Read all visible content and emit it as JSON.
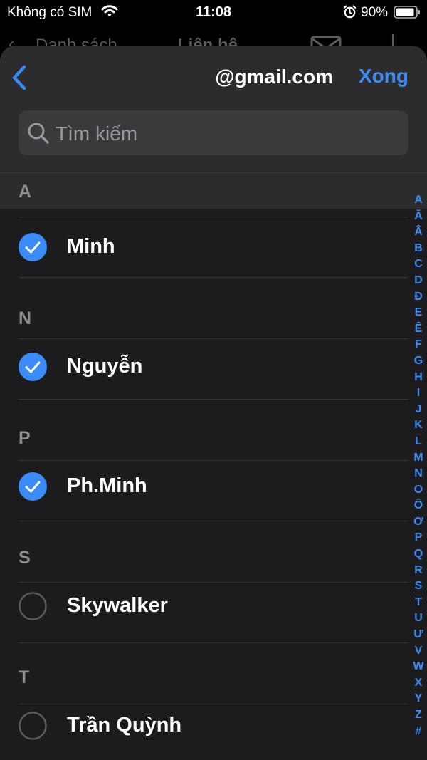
{
  "status_bar": {
    "carrier": "Không có SIM",
    "time": "11:08",
    "battery": "90%",
    "icons": [
      "wifi-icon",
      "alarm-icon",
      "battery-icon"
    ]
  },
  "background_nav": {
    "back_label": "Danh sách",
    "title": "Liên hệ"
  },
  "sheet": {
    "title": "@gmail.com",
    "done_label": "Xong",
    "back_icon": "chevron-left-icon"
  },
  "search": {
    "placeholder": "Tìm kiếm"
  },
  "sections": [
    {
      "letter": "A",
      "contacts": [
        {
          "name": "Minh",
          "selected": true
        }
      ]
    },
    {
      "letter": "N",
      "contacts": [
        {
          "name": "Nguyễn",
          "selected": true
        }
      ]
    },
    {
      "letter": "P",
      "contacts": [
        {
          "name": "Ph.Minh",
          "selected": true
        }
      ]
    },
    {
      "letter": "S",
      "contacts": [
        {
          "name": "Skywalker",
          "selected": false
        }
      ]
    },
    {
      "letter": "T",
      "contacts": [
        {
          "name": "Trần Quỳnh",
          "selected": false
        }
      ]
    }
  ],
  "index": [
    "A",
    "Ă",
    "Â",
    "B",
    "C",
    "D",
    "Đ",
    "E",
    "Ê",
    "F",
    "G",
    "H",
    "I",
    "J",
    "K",
    "L",
    "M",
    "N",
    "O",
    "Ô",
    "Ơ",
    "P",
    "Q",
    "R",
    "S",
    "T",
    "U",
    "Ư",
    "V",
    "W",
    "X",
    "Y",
    "Z",
    "#"
  ],
  "colors": {
    "accent": "#3d8bf7",
    "sheet_background": "#1c1c1e",
    "header_background": "#2c2c2e",
    "section_letter": "#8e8e93",
    "unselected_circle": "#5a5a5e"
  }
}
